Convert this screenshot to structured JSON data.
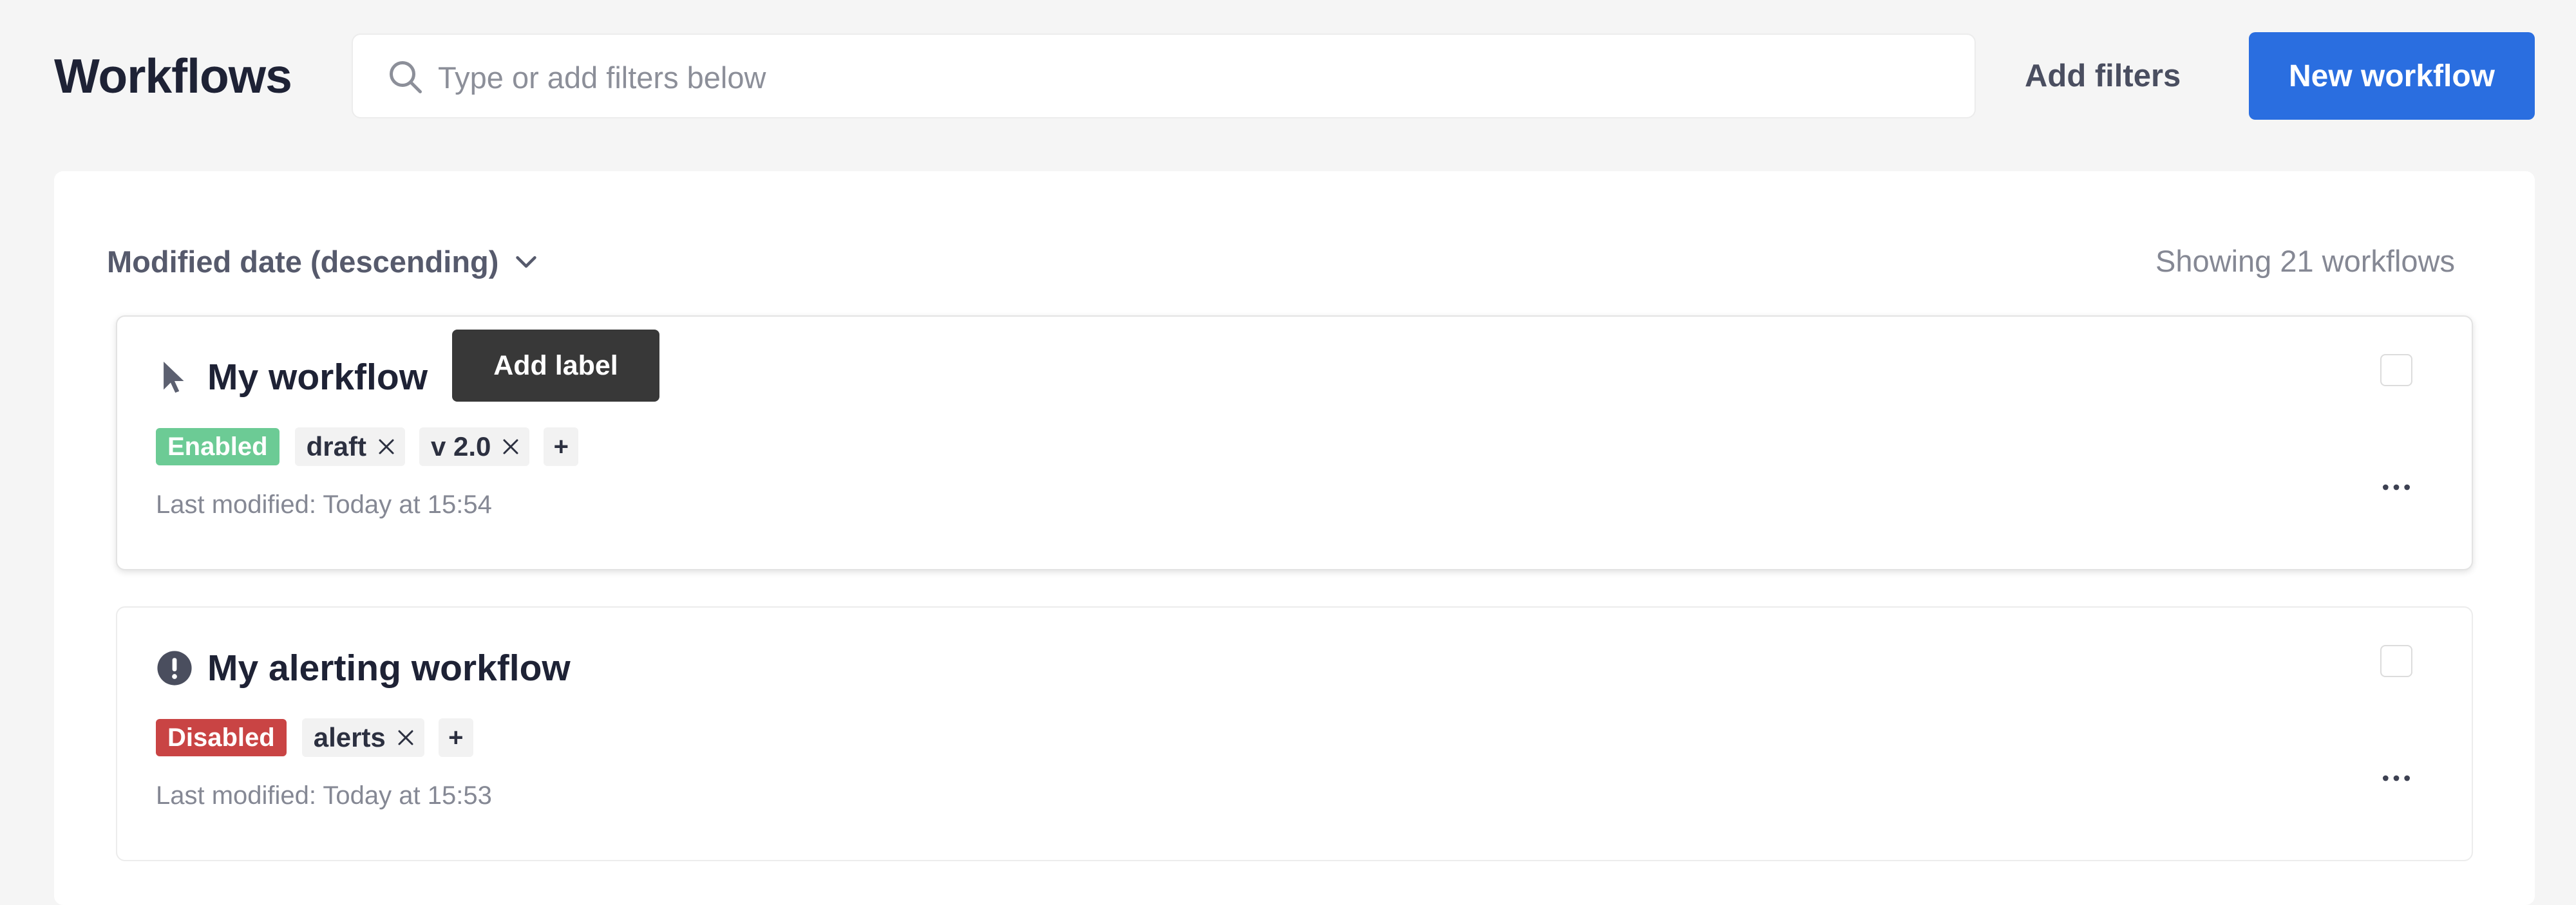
{
  "header": {
    "title": "Workflows",
    "search_placeholder": "Type or add filters below",
    "add_filters_label": "Add filters",
    "new_workflow_label": "New workflow",
    "brand_color": "#2a6ee0"
  },
  "list": {
    "sort_label": "Modified date (descending)",
    "showing_text": "Showing 21 workflows"
  },
  "workflows": [
    {
      "title": "My workflow",
      "lead_icon": "cursor-icon",
      "status": "Enabled",
      "status_color": "#6ccb95",
      "labels": [
        "draft",
        "v 2.0"
      ],
      "last_modified": "Last modified: Today at 15:54"
    },
    {
      "title": "My alerting workflow",
      "lead_icon": "alert-circle-icon",
      "status": "Disabled",
      "status_color": "#c94444",
      "labels": [
        "alerts"
      ],
      "last_modified": "Last modified: Today at 15:53"
    }
  ],
  "tooltip": {
    "text": "Add label"
  },
  "add_tag_symbol": "+"
}
